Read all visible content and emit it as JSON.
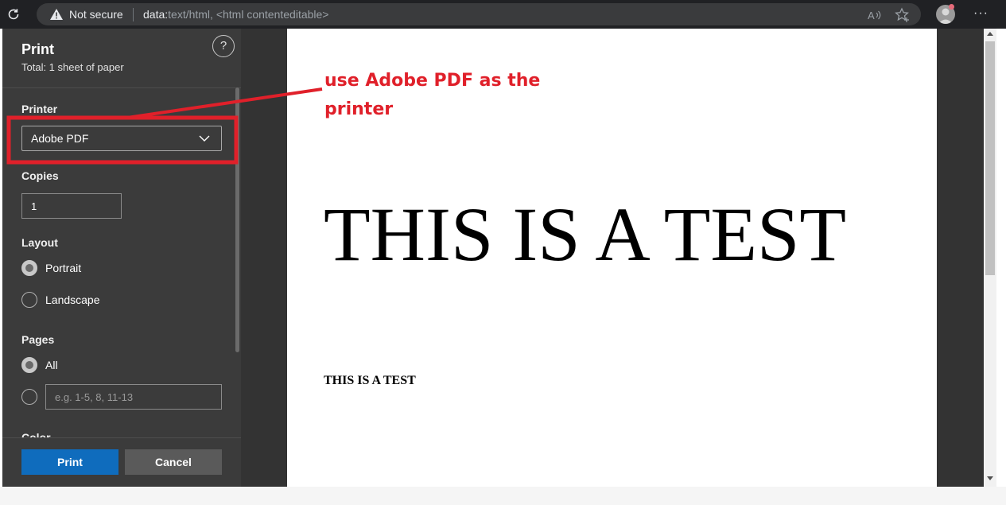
{
  "browser": {
    "security_label": "Not secure",
    "url_scheme": "data:",
    "url_rest": "text/html, <html contenteditable>",
    "read_aloud_glyph": "Aᵃ",
    "more_glyph": "···",
    "icons": [
      "reload-icon",
      "warning-icon",
      "read-aloud-icon",
      "favorites-icon",
      "profile-icon",
      "more-icon"
    ]
  },
  "print_dialog": {
    "title": "Print",
    "total": "Total: 1 sheet of paper",
    "help_glyph": "?",
    "printer": {
      "label": "Printer",
      "value": "Adobe PDF"
    },
    "copies": {
      "label": "Copies",
      "value": "1"
    },
    "layout": {
      "label": "Layout",
      "options": [
        {
          "label": "Portrait",
          "selected": true
        },
        {
          "label": "Landscape",
          "selected": false
        }
      ]
    },
    "pages": {
      "label": "Pages",
      "all_label": "All",
      "all_selected": true,
      "range_placeholder": "e.g. 1-5, 8, 11-13"
    },
    "color": {
      "label": "Color"
    },
    "buttons": {
      "print": "Print",
      "cancel": "Cancel"
    }
  },
  "preview": {
    "heading": "THIS IS A TEST",
    "small_text": "THIS IS A TEST"
  },
  "annotation": {
    "text": "use Adobe PDF as the printer",
    "color": "#e0202a"
  },
  "colors": {
    "accent": "#0f6cbd",
    "panel_bg": "#3b3b3b",
    "topbar_bg": "#202124"
  }
}
